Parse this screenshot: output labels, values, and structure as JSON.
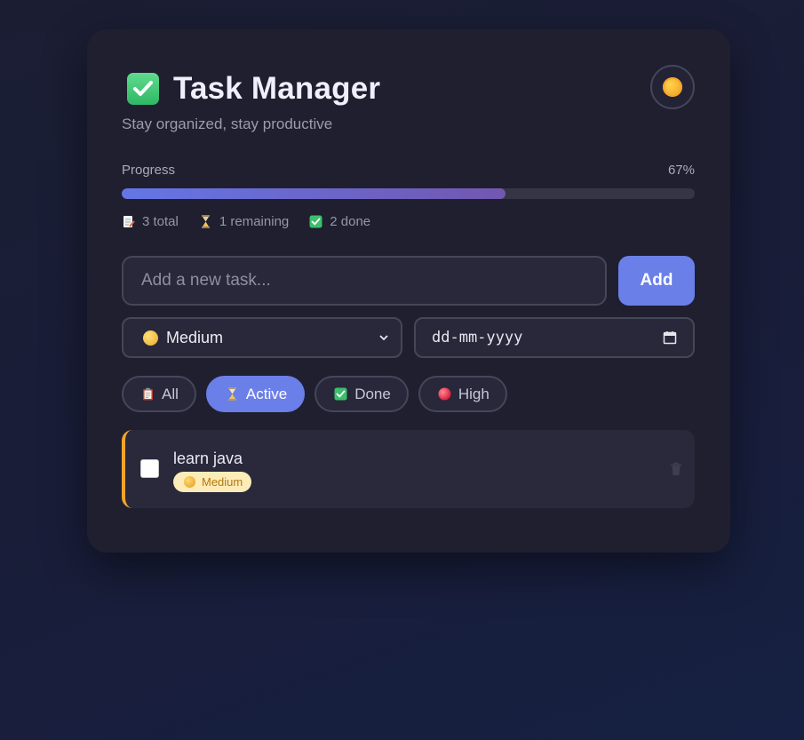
{
  "app": {
    "title": "Task Manager",
    "subtitle": "Stay organized, stay productive",
    "title_icon": "check-box-icon",
    "theme_icon": "sun-icon"
  },
  "progress": {
    "label": "Progress",
    "percent_text": "67%",
    "fraction": 0.67,
    "stats": [
      {
        "icon": "memo-icon",
        "text": "3 total"
      },
      {
        "icon": "hourglass-icon",
        "text": "1 remaining"
      },
      {
        "icon": "check-box-icon",
        "text": "2 done"
      }
    ]
  },
  "new_task": {
    "placeholder": "Add a new task...",
    "value": "",
    "add_label": "Add"
  },
  "priority_select": {
    "selected": "Medium",
    "icon": "yellow-circle-icon"
  },
  "due_date": {
    "value": "dd-mm-yyyy"
  },
  "filters": [
    {
      "label": "All",
      "icon": "clipboard-icon",
      "active": false
    },
    {
      "label": "Active",
      "icon": "hourglass-icon",
      "active": true
    },
    {
      "label": "Done",
      "icon": "check-box-icon",
      "active": false
    },
    {
      "label": "High",
      "icon": "red-circle-icon",
      "active": false
    }
  ],
  "tasks": [
    {
      "text": "learn java",
      "priority": "Medium",
      "done": false
    }
  ],
  "colors": {
    "accent": "#6a7fe8",
    "medium_priority": "#f0a42a",
    "card_bg": "#1f1f2f"
  }
}
